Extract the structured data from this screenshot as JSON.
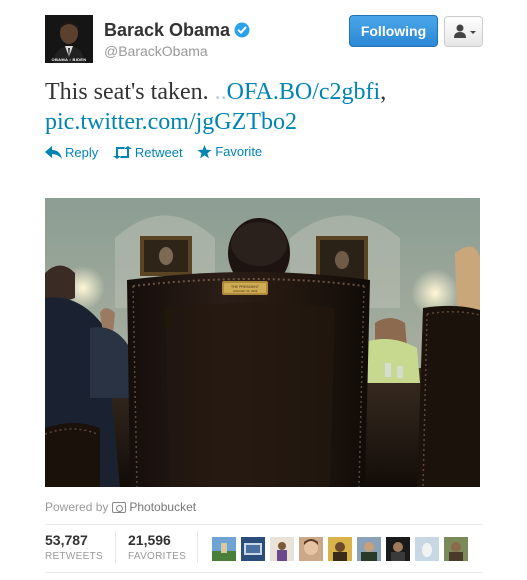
{
  "user": {
    "name": "Barack Obama",
    "handle": "@BarackObama",
    "avatar_caption": "OBAMA • BIDEN",
    "verified": true
  },
  "header": {
    "following_label": "Following",
    "user_menu_icon": "user-dropdown-icon"
  },
  "tweet": {
    "text_prefix": "This seat's taken. ",
    "link_dots": "..",
    "link1": "OFA.BO/c2gbfi",
    "separator": ",",
    "link2": "pic.twitter.com/jgGZTbo2"
  },
  "actions": {
    "reply": "Reply",
    "retweet": "Retweet",
    "favorite": "Favorite"
  },
  "photo": {
    "plaque_line1": "THE PRESIDENT",
    "plaque_line2": "JANUARY 20, 2009"
  },
  "powered_by": {
    "prefix": "Powered by",
    "provider": "Photobucket"
  },
  "stats": {
    "retweets_count": "53,787",
    "retweets_label": "RETWEETS",
    "favorites_count": "21,596",
    "favorites_label": "FAVORITES"
  },
  "colors": {
    "link": "#0084b4",
    "follow_button": "#2d88d6",
    "verified_badge": "#2aa3ef"
  }
}
